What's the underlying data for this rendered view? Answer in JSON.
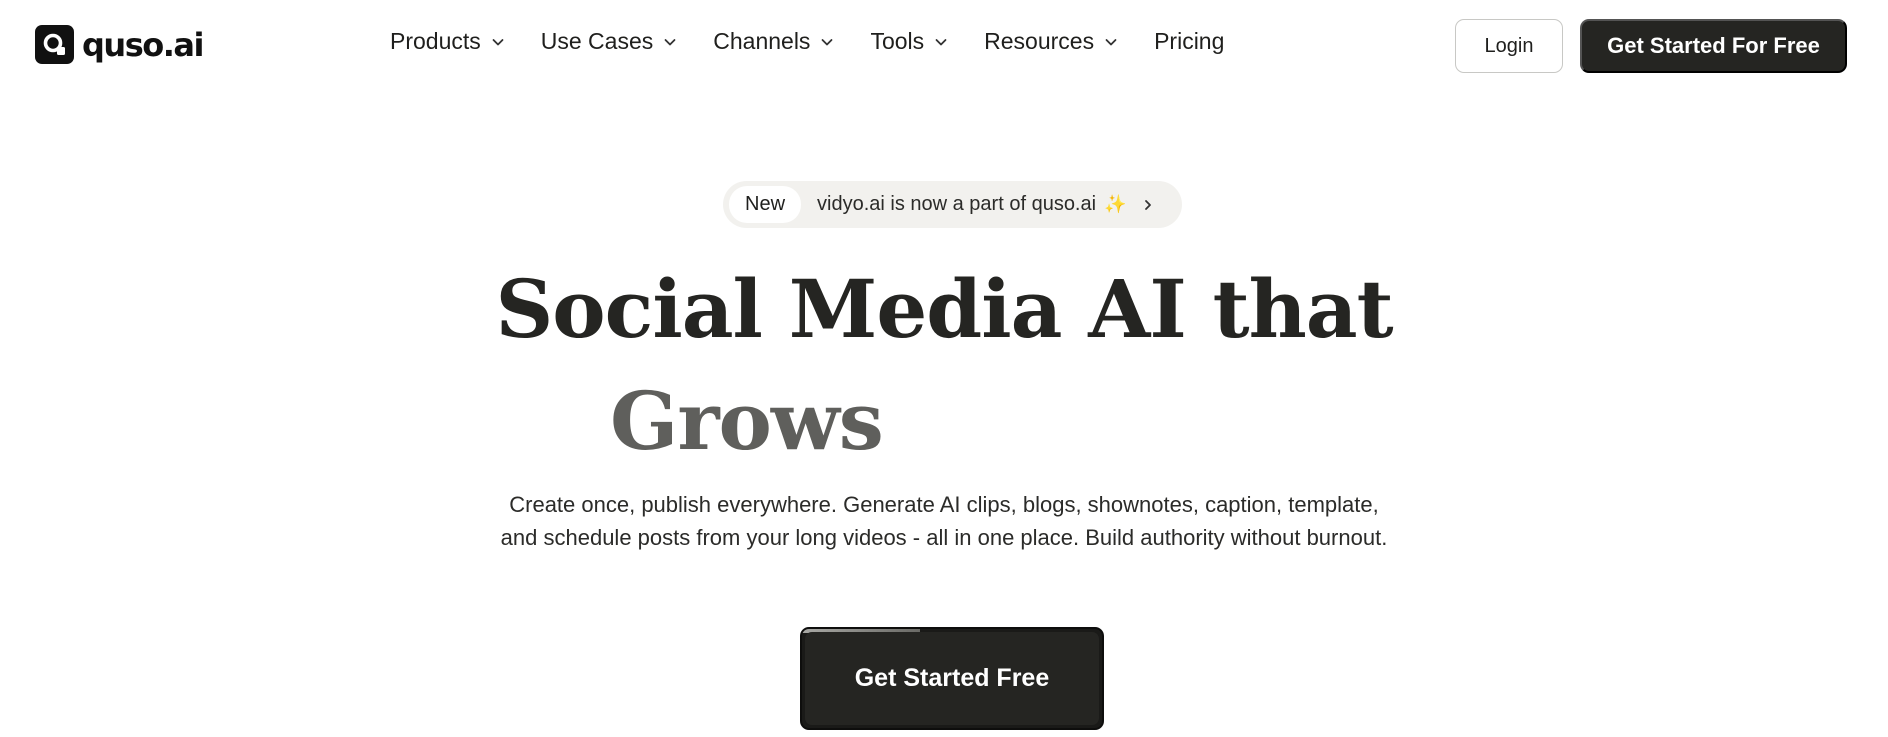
{
  "brand": {
    "name": "quso.ai"
  },
  "nav": {
    "items": [
      {
        "label": "Products",
        "has_dropdown": true
      },
      {
        "label": "Use Cases",
        "has_dropdown": true
      },
      {
        "label": "Channels",
        "has_dropdown": true
      },
      {
        "label": "Tools",
        "has_dropdown": true
      },
      {
        "label": "Resources",
        "has_dropdown": true
      },
      {
        "label": "Pricing",
        "has_dropdown": false
      }
    ],
    "login_label": "Login",
    "cta_label": "Get Started For Free"
  },
  "announcement": {
    "badge": "New",
    "text": "vidyo.ai is now a part of quso.ai",
    "emoji": "✨",
    "arrow": "›"
  },
  "hero": {
    "title_line1": "Social Media AI that",
    "title_line2": "Grows",
    "subtitle": "Create once, publish everywhere. Generate AI clips, blogs, shownotes, caption, template, and schedule posts from your long videos - all in one place. Build authority without burnout.",
    "cta_label": "Get Started Free"
  },
  "colors": {
    "primary_dark": "#252522",
    "text": "#1f1f1d",
    "muted_heading": "#5f5f5c",
    "pill_bg": "#f2f1ee",
    "sparkle": "#e9b83a"
  },
  "icons": {
    "dropdown": "chevron-down-icon",
    "announce_arrow": "chevron-right-icon",
    "logo": "quso-logo-icon"
  }
}
